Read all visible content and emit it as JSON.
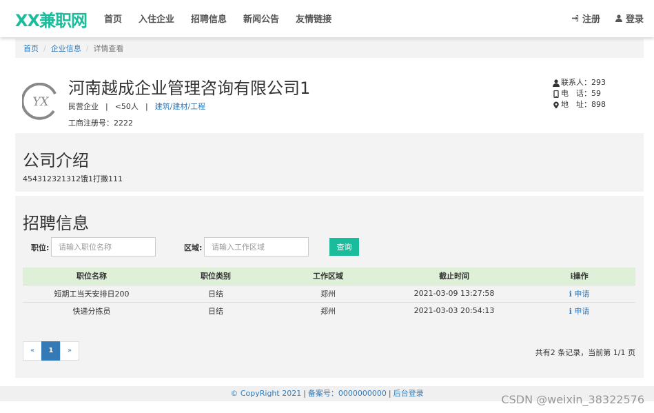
{
  "nav": {
    "brand": "XX兼职网",
    "links": [
      "首页",
      "入住企业",
      "招聘信息",
      "新闻公告",
      "友情链接"
    ],
    "register": "注册",
    "login": "登录"
  },
  "breadcrumb": [
    "首页",
    "企业信息",
    "详情查看"
  ],
  "company": {
    "logo_text": "YX",
    "name": "河南越成企业管理咨询有限公司1",
    "type": "民营企业",
    "size": "<50人",
    "industry": "建筑/建材/工程",
    "reg_label": "工商注册号：",
    "reg_value": "2222",
    "contact_label": "联系人：",
    "contact_value": "293",
    "phone_label": "电　话：",
    "phone_value": "59",
    "address_label": "地　址：",
    "address_value": "898"
  },
  "intro": {
    "title": "公司介绍",
    "text": "454312321312饿1打撒111"
  },
  "jobs": {
    "title": "招聘信息",
    "position_label": "职位:",
    "position_placeholder": "请输入职位名称",
    "area_label": "区域:",
    "area_placeholder": "请输入工作区域",
    "search_button": "查询",
    "columns": [
      "职位名称",
      "职位类别",
      "工作区域",
      "截止时间",
      "操作"
    ],
    "rows": [
      {
        "name": "短期工当天安排日200",
        "category": "日结",
        "area": "郑州",
        "deadline": "2021-03-09 13:27:58",
        "action": "申请"
      },
      {
        "name": "快递分拣员",
        "category": "日结",
        "area": "郑州",
        "deadline": "2021-03-03 20:54:13",
        "action": "申请"
      }
    ],
    "pagination": {
      "prev": "«",
      "current": "1",
      "next": "»"
    },
    "page_info": "共有2 条记录，当前第 1/1 页"
  },
  "footer": {
    "copyright": "© CopyRight 2021",
    "record": "备案号：0000000000",
    "admin": "后台登录"
  },
  "watermark": "CSDN @weixin_38322576",
  "colors": {
    "accent": "#1abc9c",
    "link": "#337ab7",
    "table_head": "#dff0d8",
    "panel": "#f3f3f3"
  }
}
